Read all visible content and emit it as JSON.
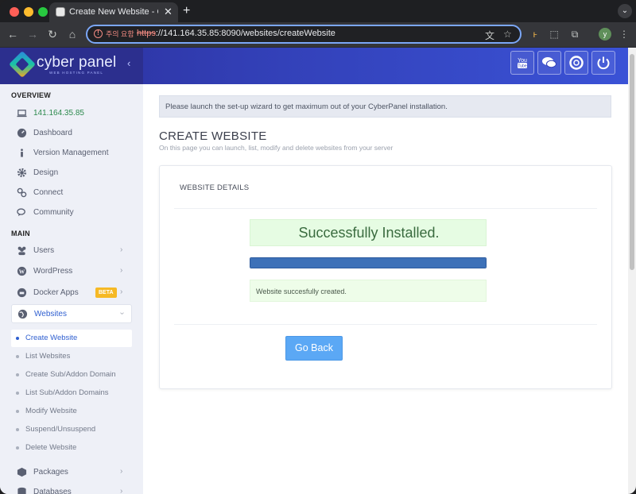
{
  "browser": {
    "tab_title": "Create New Website - CyberPanel",
    "security_label": "주의 요함",
    "url_scheme": "https",
    "url_rest": "://141.164.35.85:8090/websites/createWebsite",
    "profile_initial": "y"
  },
  "header": {
    "brand": "cyber panel",
    "tagline": "WEB HOSTING PANEL",
    "buttons": [
      "youtube-icon",
      "chat-icon",
      "support-icon",
      "power-icon"
    ]
  },
  "sidebar": {
    "overview_title": "OVERVIEW",
    "main_title": "MAIN",
    "overview_items": [
      {
        "label": "141.164.35.85",
        "icon": "laptop-icon"
      },
      {
        "label": "Dashboard",
        "icon": "dashboard-icon"
      },
      {
        "label": "Version Management",
        "icon": "info-icon"
      },
      {
        "label": "Design",
        "icon": "gear-icon"
      },
      {
        "label": "Connect",
        "icon": "link-icon"
      },
      {
        "label": "Community",
        "icon": "comments-icon"
      }
    ],
    "main_items": [
      {
        "label": "Users",
        "icon": "users-icon"
      },
      {
        "label": "WordPress",
        "icon": "wordpress-icon"
      },
      {
        "label": "Docker Apps",
        "icon": "docker-icon",
        "badge": "BETA"
      },
      {
        "label": "Websites",
        "icon": "globe-icon"
      }
    ],
    "website_subitems": [
      "Create Website",
      "List Websites",
      "Create Sub/Addon Domain",
      "List Sub/Addon Domains",
      "Modify Website",
      "Suspend/Unsuspend",
      "Delete Website"
    ],
    "bottom_items": [
      {
        "label": "Packages",
        "icon": "package-icon"
      },
      {
        "label": "Databases",
        "icon": "database-icon"
      }
    ]
  },
  "main": {
    "notice": "Please launch the set-up wizard to get maximum out of your CyberPanel installation.",
    "title": "CREATE WEBSITE",
    "subtitle": "On this page you can launch, list, modify and delete websites from your server",
    "card_title": "WEBSITE DETAILS",
    "success": "Successfully Installed.",
    "progress_percent": 100,
    "message": "Website succesfully created.",
    "go_back": "Go Back"
  },
  "colors": {
    "accent": "#3a52d6",
    "success_bg": "#e6fce3",
    "progress": "#3d71b8",
    "button": "#5ba8f5"
  }
}
